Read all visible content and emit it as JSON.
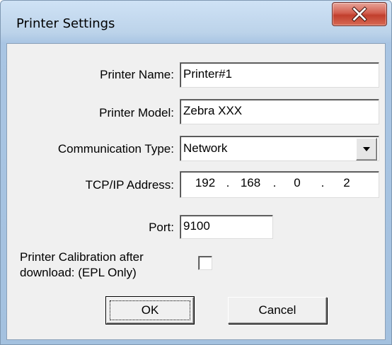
{
  "window": {
    "title": "Printer Settings"
  },
  "icons": {
    "close": "close-icon",
    "combo_arrow": "chevron-down-icon"
  },
  "colors": {
    "client_background": "#f0f0f0",
    "close_button": "#c13f2d",
    "frame": "#a9c5e3"
  },
  "form": {
    "printer_name": {
      "label": "Printer Name:",
      "value": "Printer#1"
    },
    "printer_model": {
      "label": "Printer Model:",
      "value": "Zebra XXX"
    },
    "communication_type": {
      "label": "Communication Type:",
      "selected": "Network"
    },
    "tcp_ip_address": {
      "label": "TCP/IP Address:",
      "octets": [
        "192",
        "168",
        "0",
        "2"
      ],
      "separator": "."
    },
    "port": {
      "label": "Port:",
      "value": "9100"
    },
    "calibration": {
      "label_line1": "Printer Calibration after",
      "label_line2": "download: (EPL Only)",
      "checked": false
    }
  },
  "buttons": {
    "ok": "OK",
    "cancel": "Cancel"
  }
}
